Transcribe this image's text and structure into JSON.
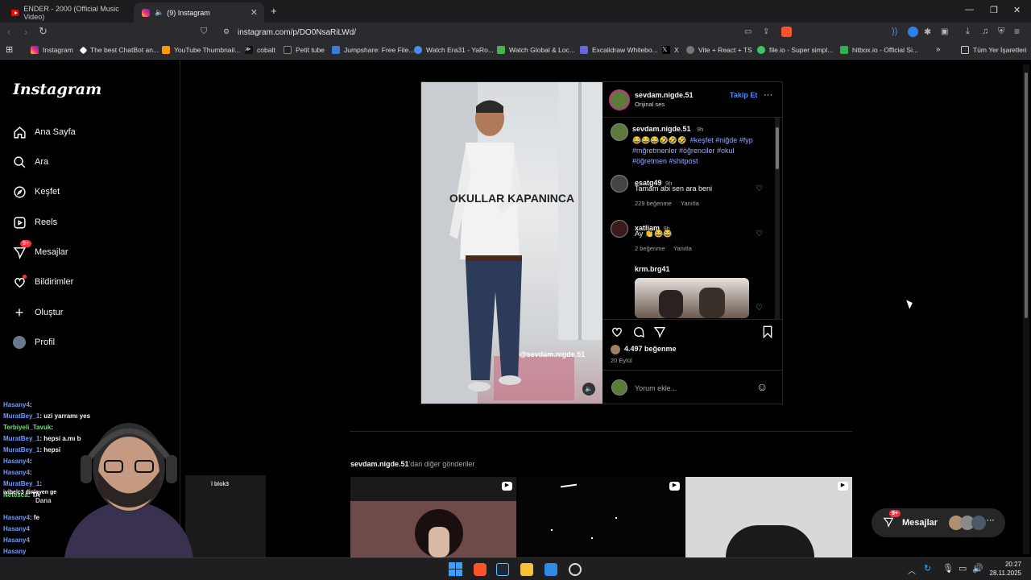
{
  "browser": {
    "tabs": [
      {
        "title": "ENDER - 2000 (Official Music Video)",
        "icon": "youtube-icon"
      },
      {
        "title": "(9) Instagram",
        "icon": "instagram-icon"
      }
    ],
    "new_tab": "+",
    "url": "instagram.com/p/DO0NsaRiLWd/",
    "bookmarks": [
      "Instagram",
      "The best ChatBot an...",
      "YouTube Thumbnail...",
      "cobalt",
      "Petit tube",
      "Jumpshare: Free File...",
      "Watch Era31 - YaRo...",
      "Watch Global & Loc...",
      "Excalidraw Whitebo...",
      "X",
      "Vite + React + TS",
      "file.io - Super simpl...",
      "hitbox.io - Official Si..."
    ],
    "all_bookmarks": "Tüm Yer İşaretleri"
  },
  "instagram": {
    "logo": "Instagram",
    "nav": [
      {
        "label": "Ana Sayfa",
        "icon": "home-icon"
      },
      {
        "label": "Ara",
        "icon": "search-icon"
      },
      {
        "label": "Keşfet",
        "icon": "explore-icon"
      },
      {
        "label": "Reels",
        "icon": "reels-icon"
      },
      {
        "label": "Mesajlar",
        "icon": "messages-icon",
        "badge": "9+"
      },
      {
        "label": "Bildirimler",
        "icon": "heart-icon"
      },
      {
        "label": "Oluştur",
        "icon": "plus-icon"
      },
      {
        "label": "Profil",
        "icon": "profile-avatar"
      }
    ],
    "post": {
      "author": "sevdam.nigde.51",
      "audio": "Orijinal ses",
      "follow": "Takip Et",
      "media_caption": "OKULLAR KAPANINCA",
      "media_handle": "@sevdam.nigde.51",
      "caption": {
        "user": "sevdam.nigde.51",
        "time": "9h",
        "emojis": "😂😂😂🤣🤣🤣",
        "tags": "#keşfet #niğde #fyp #mğretmenler #öğrenciler #okul #öğretmen #shitpost"
      },
      "comments": [
        {
          "user": "esatg49",
          "time": "9h",
          "text": "Tamam abi sen ara beni",
          "likes": "229 beğenme",
          "reply": "Yanıtla"
        },
        {
          "user": "xatliam",
          "time": "9h",
          "text": "Ay 👏😂😂",
          "likes": "2 beğenme",
          "reply": "Yanıtla"
        },
        {
          "user": "krm.brg41",
          "time": "",
          "text": "",
          "likes": "",
          "reply": ""
        }
      ],
      "likes": "4.497 beğenme",
      "date": "20 Eylül",
      "comment_placeholder": "Yorum ekle..."
    },
    "more_posts": {
      "user": "sevdam.nigde.51",
      "suffix": "'dan diğer gönderiler"
    },
    "messages_float": {
      "label": "Mesajlar",
      "badge": "9+"
    }
  },
  "chat": [
    {
      "user": "Hasany4",
      "msg": ":"
    },
    {
      "user": "MuratBey_1",
      "msg": ": uzi yarramı yes"
    },
    {
      "user": "Terbiyeli_Tavuk",
      "msg": ":"
    },
    {
      "user": "MuratBey_1",
      "msg": ": hepsi a.mı b"
    },
    {
      "user": "MuratBey_1",
      "msg": ": hepsi"
    },
    {
      "user": "Hasany4",
      "msg": ":"
    },
    {
      "user": "Hasany4",
      "msg": ":"
    },
    {
      "user": "MuratBey_1",
      "msg": ":"
    },
    {
      "user": "Netesca",
      "msg": ": TA"
    },
    {
      "user": "Hasany4",
      "msg": ": fe"
    },
    {
      "user": "Hasany4",
      "msg": ""
    },
    {
      "user": "Hasany4",
      "msg": ""
    },
    {
      "user": "Hasany",
      "msg": ""
    }
  ],
  "overlay_texts": {
    "dinleyen": "ivibelc3 dinleyen ge",
    "dana": "Dana",
    "blok": "l blok3"
  },
  "taskbar": {
    "time": "20:27",
    "date": "28.11.2025"
  }
}
